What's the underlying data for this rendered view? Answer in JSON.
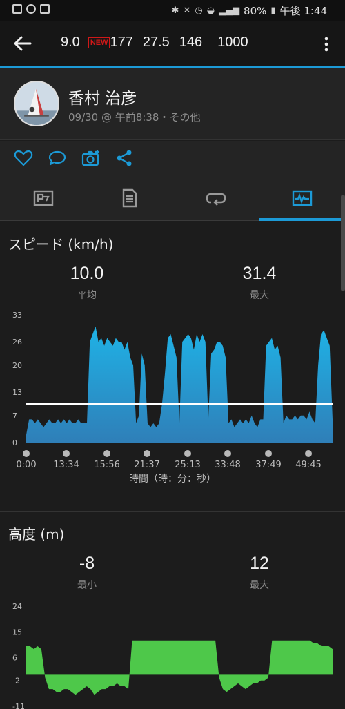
{
  "statusbar": {
    "battery": "80%",
    "time": "午後 1:44"
  },
  "appbar": {
    "metric1": "9.0",
    "new_badge": "NEW",
    "metric2": "177",
    "metric3": "27.5",
    "metric4": "146",
    "metric5": "1000"
  },
  "profile": {
    "name": "香村 治彦",
    "subtitle": "09/30 @ 午前8:38・その他"
  },
  "speed": {
    "title": "スピード (km/h)",
    "avg_value": "10.0",
    "avg_label": "平均",
    "max_value": "31.4",
    "max_label": "最大",
    "xaxis_title": "時間（時：分：秒）"
  },
  "altitude": {
    "title": "高度 (m)",
    "min_value": "-8",
    "min_label": "最小",
    "max_value": "12",
    "max_label": "最大"
  },
  "colors": {
    "accent": "#1c9ad6",
    "speed_fill": "#2aa5dc",
    "altitude_fill": "#4ec84a"
  },
  "chart_data": [
    {
      "type": "area",
      "title": "スピード (km/h)",
      "xlabel": "時間（時：分：秒）",
      "ylabel": "",
      "x_ticks": [
        "0:00",
        "13:34",
        "15:56",
        "21:37",
        "25:13",
        "33:48",
        "37:49",
        "49:45"
      ],
      "y_ticks": [
        0,
        7,
        13,
        20,
        26,
        33
      ],
      "ylim": [
        0,
        33
      ],
      "average_line": 10.0,
      "values": [
        2,
        6,
        6,
        5,
        6,
        5,
        4,
        5,
        6,
        5,
        5,
        6,
        5,
        6,
        5,
        6,
        5,
        5,
        6,
        5,
        5,
        5,
        26,
        28,
        30,
        26,
        27,
        25,
        27,
        26,
        25,
        27,
        26,
        26,
        24,
        26,
        22,
        20,
        5,
        7,
        23,
        20,
        5,
        4,
        5,
        4,
        5,
        10,
        18,
        27,
        28,
        25,
        22,
        5,
        26,
        27,
        28,
        27,
        24,
        28,
        26,
        28,
        26,
        6,
        23,
        24,
        26,
        26,
        25,
        22,
        5,
        6,
        4,
        5,
        6,
        5,
        6,
        5,
        7,
        5,
        4,
        6,
        6,
        25,
        26,
        27,
        24,
        25,
        22,
        5,
        7,
        6,
        6,
        7,
        6,
        7,
        7,
        6,
        8,
        6,
        5,
        20,
        28,
        29,
        27,
        25,
        6
      ]
    },
    {
      "type": "area",
      "title": "高度 (m)",
      "xlabel": "",
      "ylabel": "",
      "y_ticks": [
        24,
        15,
        6,
        -2,
        -11
      ],
      "ylim": [
        -11,
        24
      ],
      "values": [
        10,
        10,
        9,
        10,
        9,
        -1,
        -5,
        -5,
        -6,
        -6,
        -5,
        -5,
        -6,
        -7,
        -6,
        -5,
        -4,
        -5,
        -7,
        -6,
        -5,
        -5,
        -4,
        -4,
        -3,
        -4,
        -4,
        -5,
        12,
        12,
        12,
        12,
        12,
        12,
        12,
        12,
        12,
        12,
        12,
        12,
        12,
        12,
        12,
        12,
        12,
        12,
        12,
        12,
        12,
        12,
        12,
        -1,
        -5,
        -6,
        -5,
        -4,
        -3,
        -4,
        -5,
        -4,
        -3,
        -3,
        -2,
        -2,
        -1,
        12,
        12,
        12,
        12,
        12,
        12,
        12,
        12,
        12,
        12,
        12,
        11,
        11,
        10,
        10,
        10,
        9
      ]
    }
  ]
}
